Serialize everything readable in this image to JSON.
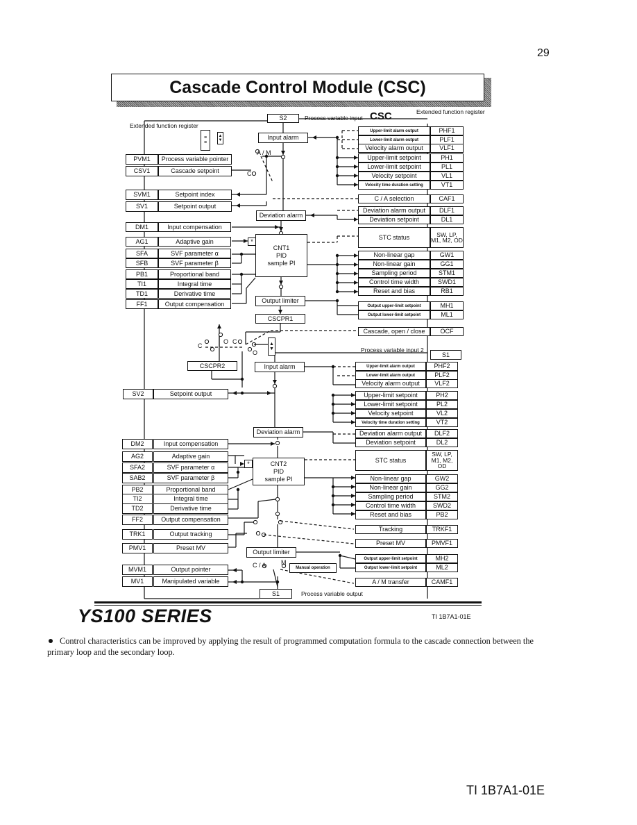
{
  "page_number": "29",
  "title": "Cascade Control Module (CSC)",
  "diagram": {
    "module_label": "CSC",
    "extended_function_register_label_left": "Extended function register",
    "extended_function_register_label_right": "Extended function register",
    "s2": "S2",
    "process_variable_input": "Process variable input",
    "process_variable_input_2": "Process variable input 2",
    "process_variable_output": "Process variable output",
    "s1_in": "S1",
    "s1_out": "S1",
    "input_alarm_1": "Input alarm",
    "input_alarm_2": "Input alarm",
    "deviation_alarm_1": "Deviation alarm",
    "deviation_alarm_2": "Deviation alarm",
    "output_limiter_1": "Output limiter",
    "output_limiter_2": "Output limiter",
    "cscpr1": "CSCPR1",
    "cscpr2": "CSCPR2",
    "cnt1": [
      "CNT1",
      "PID",
      "sample PI"
    ],
    "cnt2": [
      "CNT2",
      "PID",
      "sample PI"
    ],
    "multiplier": "*",
    "manual_operation": "Manual operation",
    "switch_labels": {
      "am": "A / M",
      "c": "C",
      "o": "O",
      "ca": "C / A",
      "m": "M"
    },
    "left_registers": [
      {
        "code": "PVM1",
        "label": "Process variable pointer"
      },
      {
        "code": "CSV1",
        "label": "Cascade setpoint"
      },
      {
        "code": "SVM1",
        "label": "Setpoint index"
      },
      {
        "code": "SV1",
        "label": "Setpoint output"
      },
      {
        "code": "DM1",
        "label": "Input compensation"
      },
      {
        "code": "AG1",
        "label": "Adaptive gain"
      },
      {
        "code": "SFA",
        "label": "SVF parameter α"
      },
      {
        "code": "SFB",
        "label": "SVF parameter β"
      },
      {
        "code": "PB1",
        "label": "Proportional band"
      },
      {
        "code": "TI1",
        "label": "Integral time"
      },
      {
        "code": "TD1",
        "label": "Derivative time"
      },
      {
        "code": "FF1",
        "label": "Output compensation"
      },
      {
        "code": "SV2",
        "label": "Setpoint output"
      },
      {
        "code": "DM2",
        "label": "Input compensation"
      },
      {
        "code": "AG2",
        "label": "Adaptive gain"
      },
      {
        "code": "SFA2",
        "label": "SVF parameter α"
      },
      {
        "code": "SAB2",
        "label": "SVF parameter β"
      },
      {
        "code": "PB2",
        "label": "Proportional band"
      },
      {
        "code": "TI2",
        "label": "Integral time"
      },
      {
        "code": "TD2",
        "label": "Derivative time"
      },
      {
        "code": "FF2",
        "label": "Output compensation"
      },
      {
        "code": "TRK1",
        "label": "Output tracking"
      },
      {
        "code": "PMV1",
        "label": "Preset MV"
      },
      {
        "code": "MVM1",
        "label": "Output pointer"
      },
      {
        "code": "MV1",
        "label": "Manipulated variable"
      }
    ],
    "right_registers": [
      {
        "label": "Upper-limit alarm output",
        "code": "PHF1"
      },
      {
        "label": "Lower-limit alarm output",
        "code": "PLF1"
      },
      {
        "label": "Velocity alarm output",
        "code": "VLF1"
      },
      {
        "label": "Upper-limit setpoint",
        "code": "PH1"
      },
      {
        "label": "Lower-limit setpoint",
        "code": "PL1"
      },
      {
        "label": "Velocity setpoint",
        "code": "VL1"
      },
      {
        "label": "Velocity time duration setting",
        "code": "VT1"
      },
      {
        "label": "C / A selection",
        "code": "CAF1"
      },
      {
        "label": "Deviation alarm output",
        "code": "DLF1"
      },
      {
        "label": "Deviation setpoint",
        "code": "DL1"
      },
      {
        "label": "STC status",
        "code": "SW, LP, M1, M2, OD"
      },
      {
        "label": "Non-linear gap",
        "code": "GW1"
      },
      {
        "label": "Non-linear gain",
        "code": "GG1"
      },
      {
        "label": "Sampling period",
        "code": "STM1"
      },
      {
        "label": "Control time width",
        "code": "SWD1"
      },
      {
        "label": "Reset and bias",
        "code": "RB1"
      },
      {
        "label": "Output upper-limit setpoint",
        "code": "MH1"
      },
      {
        "label": "Output lower-limit setpoint",
        "code": "ML1"
      },
      {
        "label": "Cascade, open / close",
        "code": "OCF"
      },
      {
        "label": "Upper-limit alarm output",
        "code": "PHF2"
      },
      {
        "label": "Lower-limit alarm output",
        "code": "PLF2"
      },
      {
        "label": "Velocity alarm output",
        "code": "VLF2"
      },
      {
        "label": "Upper-limit setpoint",
        "code": "PH2"
      },
      {
        "label": "Lower-limit setpoint",
        "code": "PL2"
      },
      {
        "label": "Velocity setpoint",
        "code": "VL2"
      },
      {
        "label": "Velocity time duration setting",
        "code": "VT2"
      },
      {
        "label": "Deviation alarm output",
        "code": "DLF2"
      },
      {
        "label": "Deviation setpoint",
        "code": "DL2"
      },
      {
        "label": "STC status",
        "code": "SW, LP, M1, M2, OD"
      },
      {
        "label": "Non-linear gap",
        "code": "GW2"
      },
      {
        "label": "Non-linear gain",
        "code": "GG2"
      },
      {
        "label": "Sampling period",
        "code": "STM2"
      },
      {
        "label": "Control time width",
        "code": "SWD2"
      },
      {
        "label": "Reset and bias",
        "code": "PB2"
      },
      {
        "label": "Tracking",
        "code": "TRKF1"
      },
      {
        "label": "Preset MV",
        "code": "PMVF1"
      },
      {
        "label": "Output upper-limit setpoint",
        "code": "MH2"
      },
      {
        "label": "Output lower-limit setpoint",
        "code": "ML2"
      },
      {
        "label": "A / M transfer",
        "code": "CAMF1"
      }
    ]
  },
  "footer": {
    "series": "YS100 SERIES",
    "doc_id_small": "TI 1B7A1-01E",
    "description": "Control characteristics can be improved by applying the result of programmed computation formula to the cascade connection between the primary loop and the secondary loop.",
    "doc_id": "TI 1B7A1-01E"
  }
}
